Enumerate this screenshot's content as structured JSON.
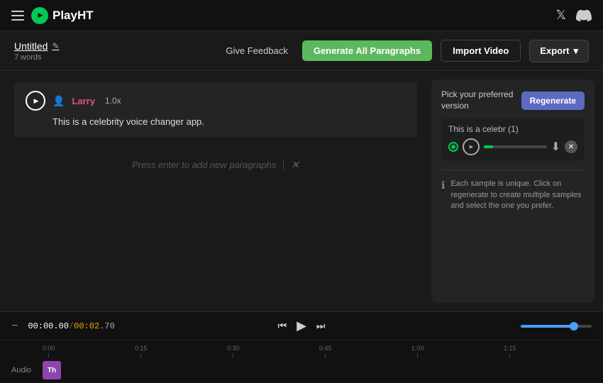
{
  "app": {
    "title": "PlayHT",
    "logo_text": "PlayHT"
  },
  "nav": {
    "twitter_label": "Twitter",
    "discord_label": "Discord"
  },
  "toolbar": {
    "doc_title": "Untitled",
    "word_count": "7 words",
    "feedback_label": "Give Feedback",
    "generate_label": "Generate All Paragraphs",
    "import_label": "Import Video",
    "export_label": "Export"
  },
  "editor": {
    "paragraph": {
      "voice": "Larry",
      "speed": "1.0x",
      "text": "This is a celebrity voice changer app."
    },
    "add_paragraph_placeholder": "Press enter to add new paragraphs"
  },
  "side_panel": {
    "title_line1": "Pick your preferred",
    "title_line2": "version",
    "regenerate_label": "Regenerate",
    "sample_label": "This is a celebr (1)",
    "info_text": "Each sample is unique. Click on regenerate to create multiple samples and select the one you prefer."
  },
  "timeline": {
    "current_time": "00:00.00",
    "total_time": "00:02.70",
    "zoom_out": "−",
    "markers": [
      "0:00",
      "0:15",
      "0:30",
      "0:45",
      "1:00",
      "1:15"
    ],
    "track_label": "Audio",
    "clip_label": "Th",
    "volume_pct": 75
  }
}
